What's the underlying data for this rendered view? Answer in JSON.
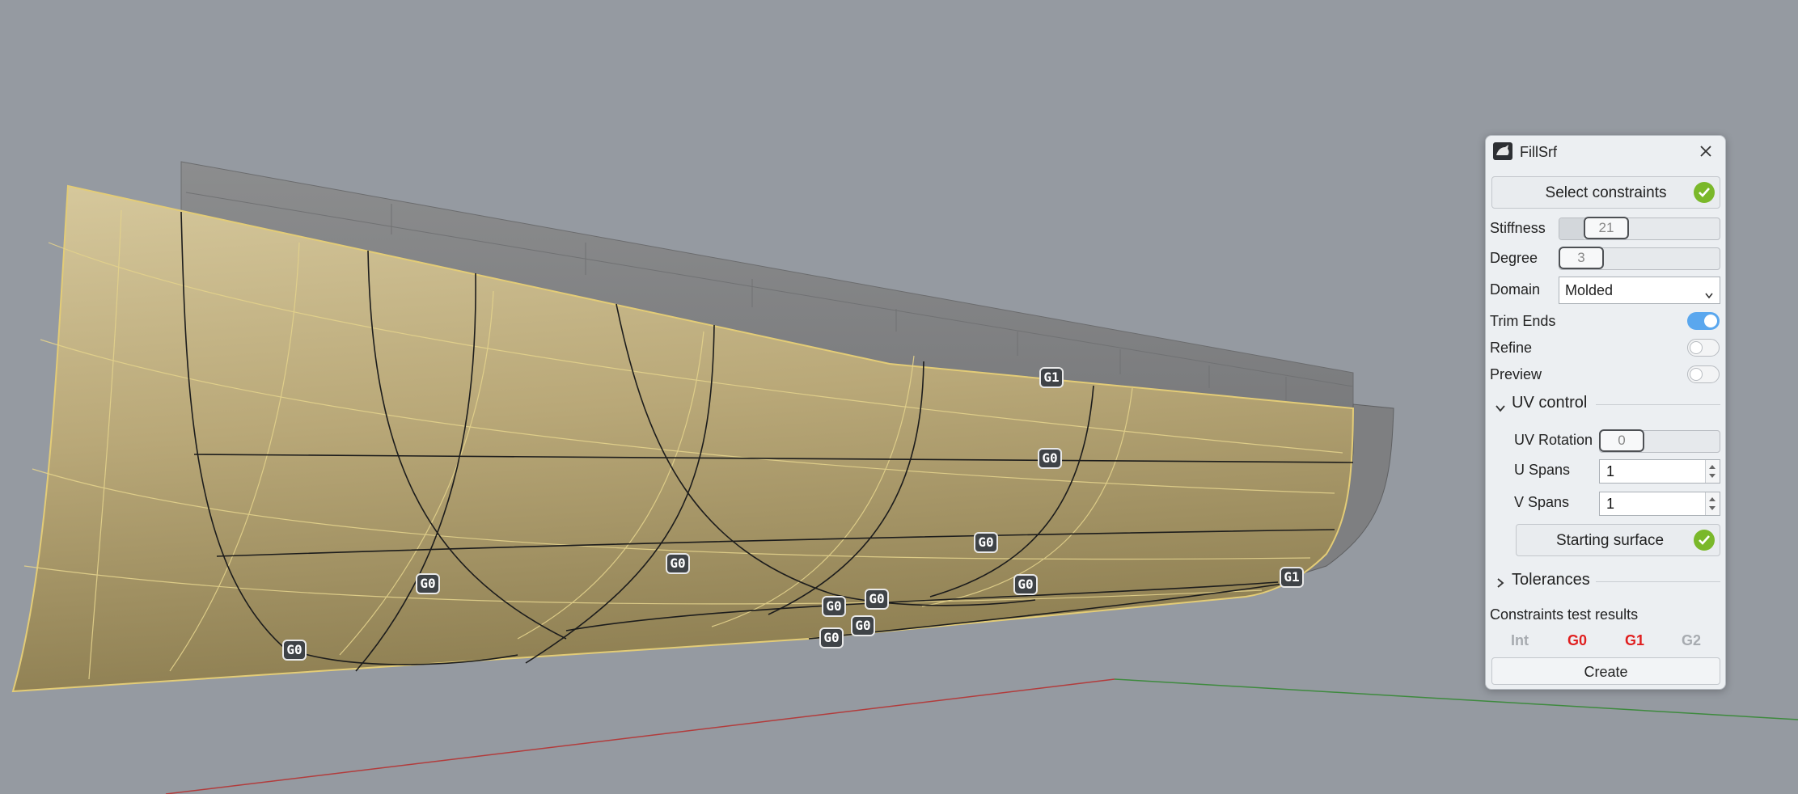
{
  "viewport": {
    "tags": [
      {
        "label": "G1",
        "color_note": "continuity"
      },
      {
        "label": "G0"
      },
      {
        "label": "G0"
      },
      {
        "label": "G0"
      },
      {
        "label": "G0"
      },
      {
        "label": "G0"
      },
      {
        "label": "G0"
      },
      {
        "label": "G0"
      },
      {
        "label": "G0"
      },
      {
        "label": "G0"
      },
      {
        "label": "G1"
      },
      {
        "label": "G0"
      }
    ]
  },
  "panel": {
    "title": "FillSrf",
    "select_constraints_label": "Select constraints",
    "stiffness": {
      "label": "Stiffness",
      "value": "21",
      "level": 0.21
    },
    "degree": {
      "label": "Degree",
      "value": "3",
      "level": 0.0
    },
    "domain": {
      "label": "Domain",
      "value": "Molded",
      "options": [
        "Molded"
      ]
    },
    "trim_ends": {
      "label": "Trim Ends",
      "on": true
    },
    "refine": {
      "label": "Refine",
      "on": false
    },
    "preview": {
      "label": "Preview",
      "on": false
    },
    "uv_control": {
      "label": "UV control",
      "uv_rotation": {
        "label": "UV Rotation",
        "value": "0"
      },
      "u_spans": {
        "label": "U Spans",
        "value": "1"
      },
      "v_spans": {
        "label": "V Spans",
        "value": "1"
      },
      "starting_surface_label": "Starting surface"
    },
    "tolerances_label": "Tolerances",
    "constraints_results": {
      "label": "Constraints test results",
      "items": [
        {
          "label": "Int",
          "color": "#a7abb0"
        },
        {
          "label": "G0",
          "color": "#e01f1f"
        },
        {
          "label": "G1",
          "color": "#e01f1f"
        },
        {
          "label": "G2",
          "color": "#a7abb0"
        }
      ]
    },
    "create_label": "Create"
  },
  "colors": {
    "background": "#959aa1",
    "surface": "#c9b98a",
    "accent_toggle": "#5aa7ee",
    "check": "#7ab82a",
    "axis_x": "#b23c3c",
    "axis_y": "#3e8a3e"
  }
}
